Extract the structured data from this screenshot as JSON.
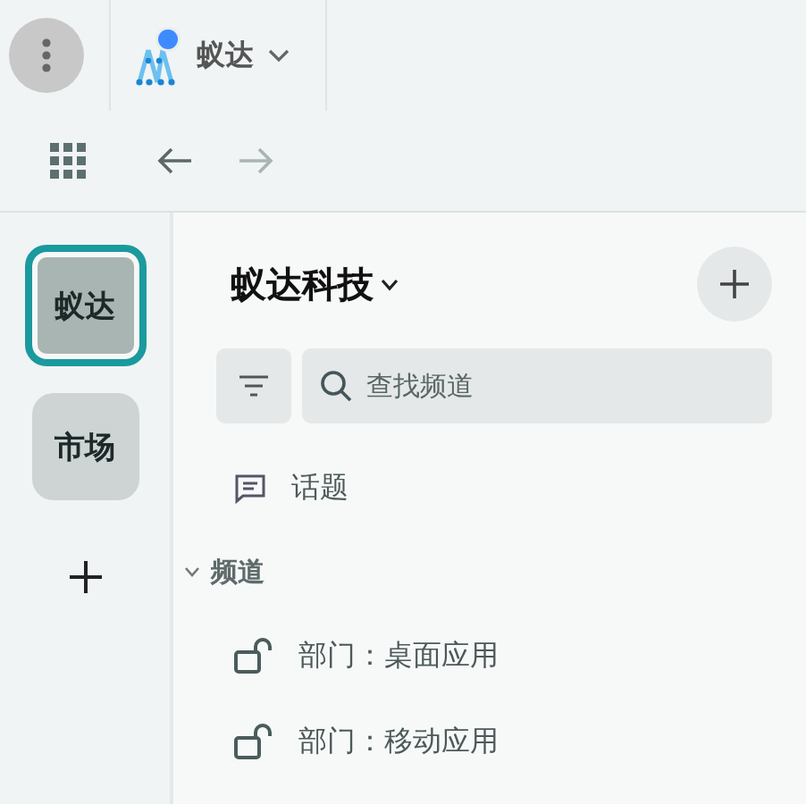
{
  "app_tab": {
    "label": "蚁达"
  },
  "nav": {
    "back": {
      "disabled": false
    },
    "forward": {
      "disabled": true
    }
  },
  "workspaces": [
    {
      "label": "蚁达",
      "selected": true
    },
    {
      "label": "市场",
      "selected": false
    }
  ],
  "org": {
    "title": "蚁达科技"
  },
  "search": {
    "placeholder": "查找频道"
  },
  "topics": {
    "label": "话题"
  },
  "section": {
    "label": "频道",
    "expanded": true
  },
  "channels": [
    {
      "name": "部门：桌面应用"
    },
    {
      "name": "部门：移动应用"
    }
  ]
}
